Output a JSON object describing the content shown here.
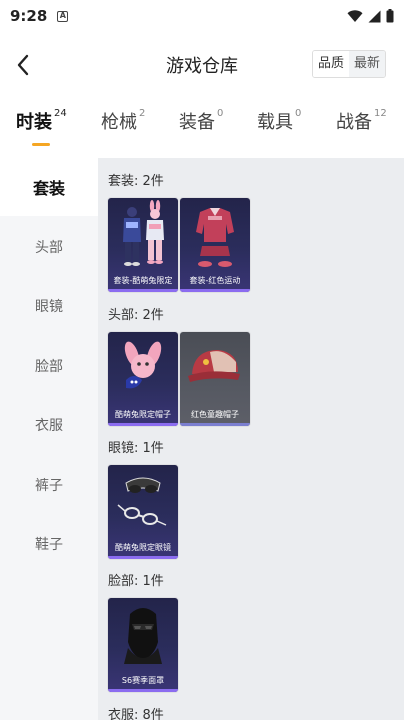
{
  "status_bar": {
    "time": "9:28",
    "notification_glyph": "A"
  },
  "header": {
    "title": "游戏仓库",
    "sort_options": [
      "品质",
      "最新"
    ]
  },
  "tabs": [
    {
      "label": "时装",
      "count": "24"
    },
    {
      "label": "枪械",
      "count": "2"
    },
    {
      "label": "装备",
      "count": "0"
    },
    {
      "label": "载具",
      "count": "0"
    },
    {
      "label": "战备",
      "count": "12"
    }
  ],
  "sidebar": {
    "items": [
      "套装",
      "头部",
      "眼镜",
      "脸部",
      "衣服",
      "裤子",
      "鞋子"
    ],
    "active": "套装"
  },
  "groups": [
    {
      "title": "套装: 2件",
      "items": [
        {
          "name": "套装-酷萌兔限定",
          "tier": "purple",
          "icon": "outfit-bunny-icon"
        },
        {
          "name": "套装-红色运动",
          "tier": "purple",
          "icon": "outfit-red-sport-icon"
        }
      ]
    },
    {
      "title": "头部: 2件",
      "items": [
        {
          "name": "酷萌兔限定帽子",
          "tier": "purple",
          "icon": "bunny-hat-icon"
        },
        {
          "name": "红色童趣帽子",
          "tier": "gray",
          "icon": "red-cap-icon"
        }
      ]
    },
    {
      "title": "眼镜: 1件",
      "items": [
        {
          "name": "酷萌兔限定眼镜",
          "tier": "purple",
          "icon": "glasses-icon"
        }
      ]
    },
    {
      "title": "脸部: 1件",
      "items": [
        {
          "name": "S6赛季面罩",
          "tier": "purple",
          "icon": "face-mask-icon"
        }
      ]
    },
    {
      "title": "衣服: 8件",
      "items": []
    }
  ],
  "colors": {
    "accent": "#f5a623",
    "purple_tier": "#2b2d5c",
    "gray_tier": "#565962"
  }
}
